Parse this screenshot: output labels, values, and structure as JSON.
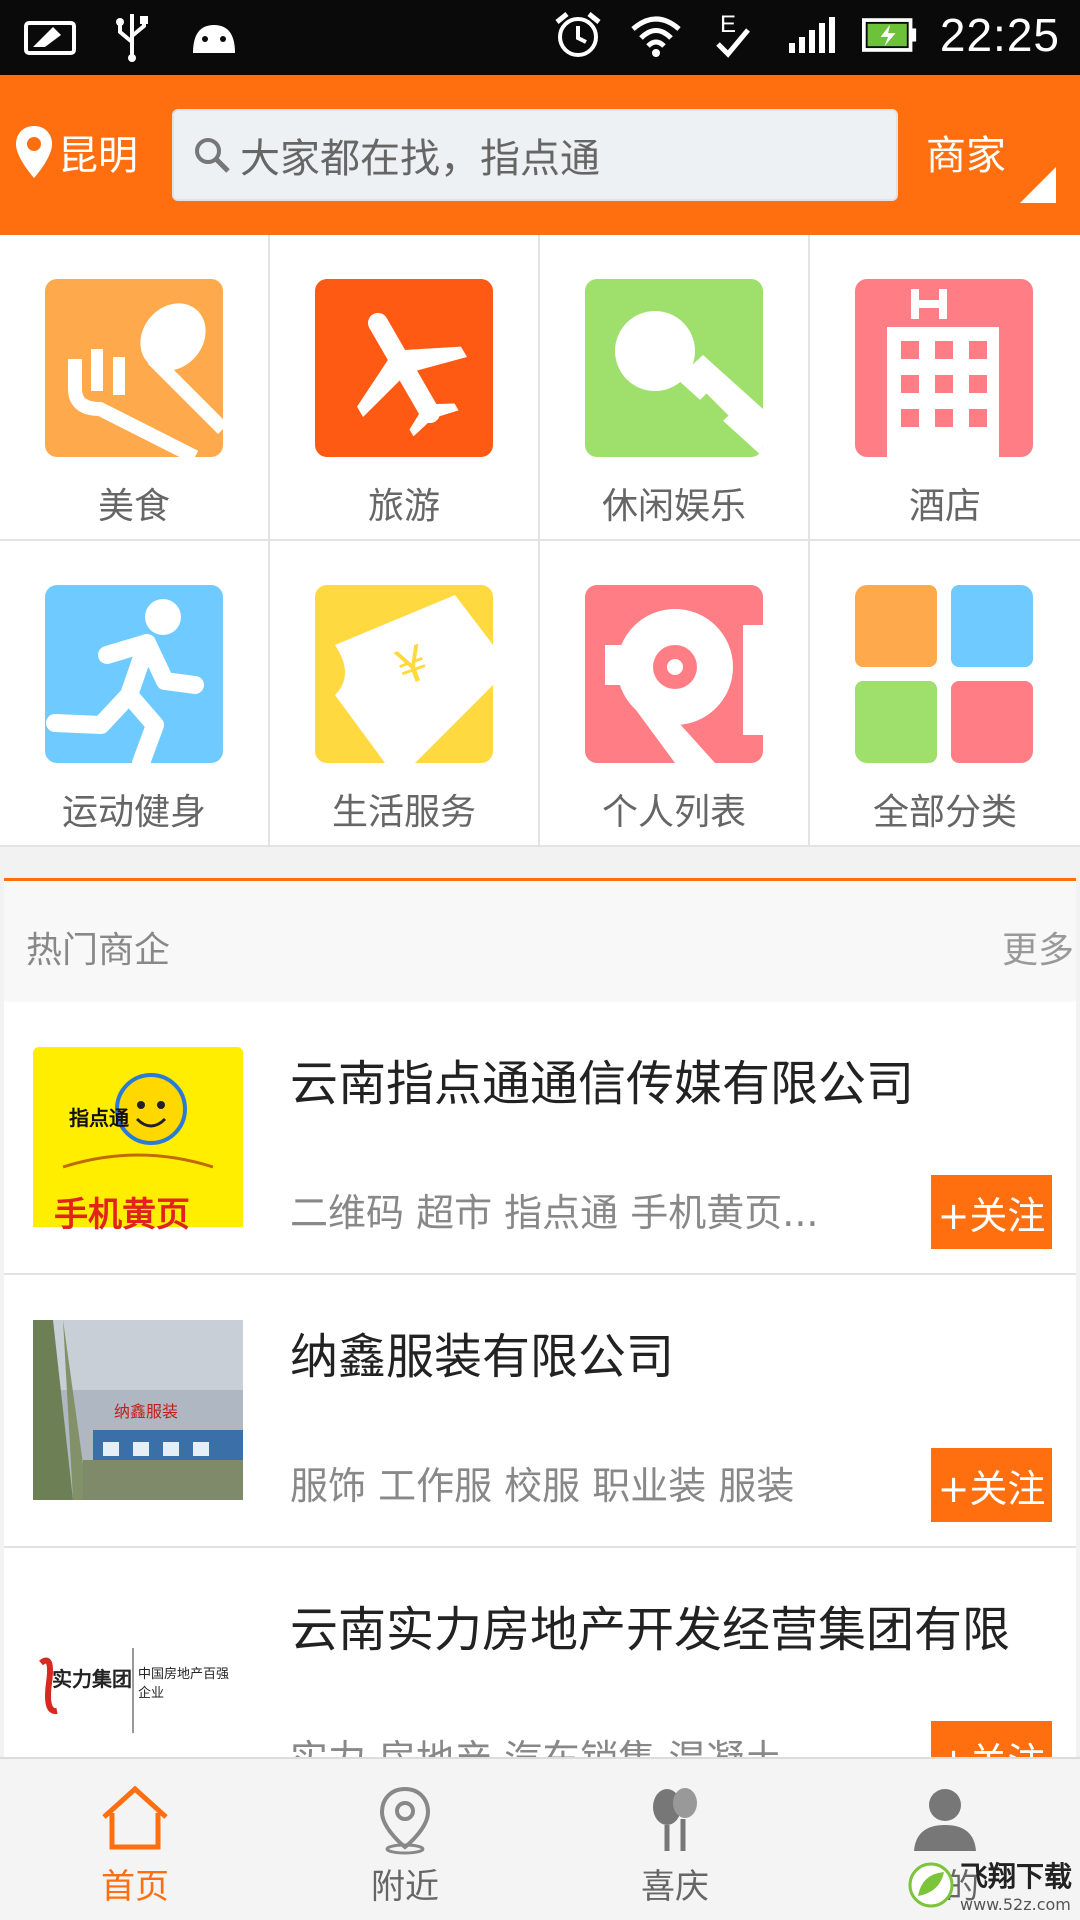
{
  "status_bar": {
    "time": "22:25",
    "icons": [
      "card-icon",
      "usb-icon",
      "android-icon",
      "alarm-icon",
      "wifi-icon",
      "edge-signal-icon",
      "cell-signal-icon",
      "battery-charging-icon"
    ]
  },
  "header": {
    "city": "昆明",
    "search_placeholder": "大家都在找，指点通",
    "merchant_label": "商家",
    "colors": {
      "accent": "#ff6f10"
    }
  },
  "categories": [
    {
      "label": "美食",
      "icon": "fork-spoon-icon",
      "color": "#ffa94d"
    },
    {
      "label": "旅游",
      "icon": "airplane-icon",
      "color": "#ff5a14"
    },
    {
      "label": "休闲娱乐",
      "icon": "microphone-icon",
      "color": "#9fe06c"
    },
    {
      "label": "酒店",
      "icon": "hotel-icon",
      "color": "#ff7e85"
    },
    {
      "label": "运动健身",
      "icon": "running-icon",
      "color": "#6fcbff"
    },
    {
      "label": "生活服务",
      "icon": "ticket-icon",
      "color": "#ffd93f"
    },
    {
      "label": "个人列表",
      "icon": "person-list-icon",
      "color": "#ff7e85"
    },
    {
      "label": "全部分类",
      "icon": "all-categories-icon",
      "color": "#ffa94d"
    }
  ],
  "hot": {
    "title": "热门商企",
    "more": "更多",
    "items": [
      {
        "name": "云南指点通通信传媒有限公司",
        "tags": "二维码 超市 指点通 手机黄页...",
        "follow": "+关注",
        "logo_text_top": "指点通",
        "logo_text_bottom": "手机黄页"
      },
      {
        "name": "纳鑫服装有限公司",
        "tags": "服饰 工作服 校服 职业装 服装",
        "follow": "+关注",
        "logo_text_sign": "纳鑫服装"
      },
      {
        "name": "云南实力房地产开发经营集团有限",
        "tags": "实力 房地产 汽车销售 混凝土",
        "follow": "+关注",
        "logo_text_left": "实力集团",
        "logo_text_right": "中国房地产百强企业"
      }
    ]
  },
  "bottom_nav": [
    {
      "label": "首页",
      "icon": "home-icon",
      "active": true
    },
    {
      "label": "附近",
      "icon": "location-pin-icon",
      "active": false
    },
    {
      "label": "喜庆",
      "icon": "balloons-icon",
      "active": false
    },
    {
      "label": "我的",
      "icon": "user-icon",
      "active": false
    }
  ],
  "watermark": {
    "text": "飞翔下载",
    "url": "www.52z.com"
  }
}
